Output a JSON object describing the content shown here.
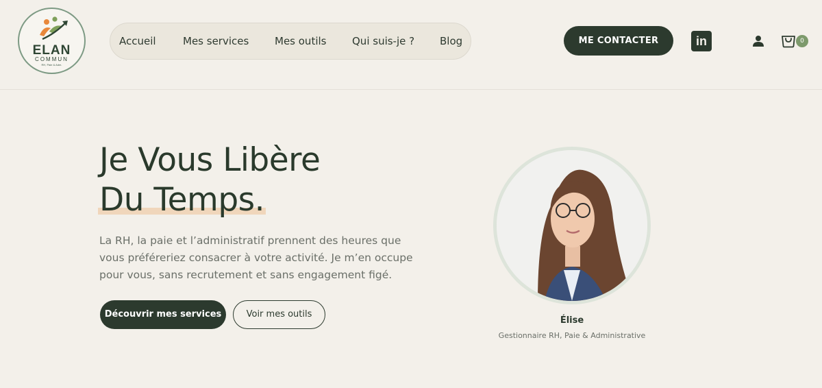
{
  "brand": {
    "name": "ELAN",
    "sub": "COMMUN",
    "tagline": "RH, Paie & Adm."
  },
  "nav": {
    "items": [
      "Accueil",
      "Mes services",
      "Mes outils",
      "Qui suis-je ?",
      "Blog"
    ]
  },
  "header": {
    "contact_label": "ME CONTACTER",
    "linkedin_label": "in",
    "cart_count": "0"
  },
  "hero": {
    "title_line1": "Je Vous Libère",
    "title_line2": "Du Temps.",
    "description": "La RH, la paie et l’administratif prennent des heures que vous préféreriez consacrer à votre activité. Je m’en occupe pour vous, sans recrutement et sans engagement figé.",
    "primary_cta": "Découvrir mes services",
    "secondary_cta": "Voir mes outils"
  },
  "profile": {
    "name": "Élise",
    "role": "Gestionnaire RH, Paie & Administrative"
  },
  "colors": {
    "background": "#f3f0ea",
    "primary": "#2c3a2e",
    "accent_underline": "#f0d6bb",
    "badge": "#7d9a6c"
  },
  "icons": [
    "linkedin-icon",
    "user-icon",
    "cart-icon"
  ]
}
